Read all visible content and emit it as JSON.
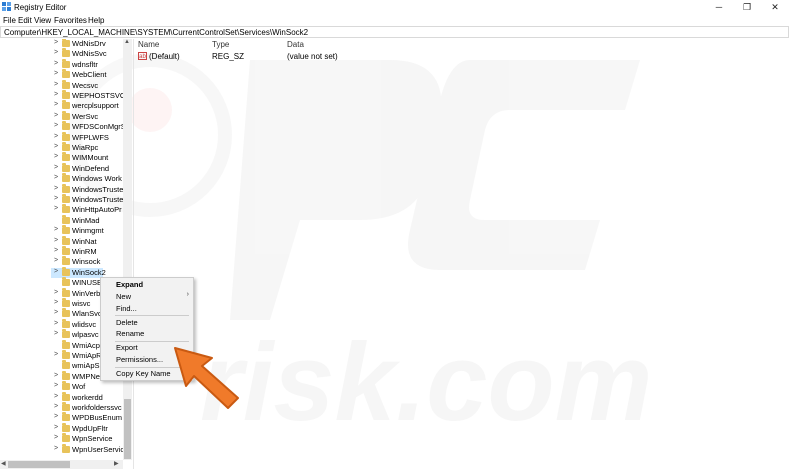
{
  "window": {
    "title": "Registry Editor",
    "minimize": "─",
    "maximize": "❐",
    "close": "✕"
  },
  "menu": [
    "File",
    "Edit",
    "View",
    "Favorites",
    "Help"
  ],
  "address": "Computer\\HKEY_LOCAL_MACHINE\\SYSTEM\\CurrentControlSet\\Services\\WinSock2",
  "tree": [
    {
      "label": "WdNisDrv",
      "chevron": ">"
    },
    {
      "label": "WdNisSvc",
      "chevron": ">"
    },
    {
      "label": "wdnsfltr",
      "chevron": ">"
    },
    {
      "label": "WebClient",
      "chevron": ">"
    },
    {
      "label": "Wecsvc",
      "chevron": ">"
    },
    {
      "label": "WEPHOSTSVC",
      "chevron": ">"
    },
    {
      "label": "wercplsupport",
      "chevron": ">"
    },
    {
      "label": "WerSvc",
      "chevron": ">"
    },
    {
      "label": "WFDSConMgrS",
      "chevron": ">"
    },
    {
      "label": "WFPLWFS",
      "chevron": ">"
    },
    {
      "label": "WiaRpc",
      "chevron": ">"
    },
    {
      "label": "WIMMount",
      "chevron": ">"
    },
    {
      "label": "WinDefend",
      "chevron": ">"
    },
    {
      "label": "Windows Work",
      "chevron": ">"
    },
    {
      "label": "WindowsTruste",
      "chevron": ">"
    },
    {
      "label": "WindowsTruste",
      "chevron": ">"
    },
    {
      "label": "WinHttpAutoPr",
      "chevron": ">"
    },
    {
      "label": "WinMad",
      "chevron": ""
    },
    {
      "label": "Winmgmt",
      "chevron": ">"
    },
    {
      "label": "WinNat",
      "chevron": ">"
    },
    {
      "label": "WinRM",
      "chevron": ">"
    },
    {
      "label": "Winsock",
      "chevron": ">"
    },
    {
      "label": "WinSock2",
      "chevron": ">",
      "selected": true
    },
    {
      "label": "WINUSB",
      "chevron": ""
    },
    {
      "label": "WinVerb",
      "chevron": ">"
    },
    {
      "label": "wisvc",
      "chevron": ">"
    },
    {
      "label": "WlanSvc",
      "chevron": ">"
    },
    {
      "label": "wlidsvc",
      "chevron": ">"
    },
    {
      "label": "wlpasvc",
      "chevron": ">"
    },
    {
      "label": "WmiAcp",
      "chevron": ""
    },
    {
      "label": "WmiApR",
      "chevron": ">"
    },
    {
      "label": "wmiApSr",
      "chevron": ""
    },
    {
      "label": "WMPNetwork",
      "chevron": ">"
    },
    {
      "label": "Wof",
      "chevron": ">"
    },
    {
      "label": "workerdd",
      "chevron": ">"
    },
    {
      "label": "workfolderssvc",
      "chevron": ">"
    },
    {
      "label": "WPDBusEnum",
      "chevron": ">"
    },
    {
      "label": "WpdUpFltr",
      "chevron": ">"
    },
    {
      "label": "WpnService",
      "chevron": ">"
    },
    {
      "label": "WpnUserServic",
      "chevron": ">"
    }
  ],
  "columns": {
    "name": "Name",
    "type": "Type",
    "data": "Data"
  },
  "values": [
    {
      "icon": "ab",
      "name": "(Default)",
      "type": "REG_SZ",
      "data": "(value not set)"
    }
  ],
  "context_menu": {
    "expand": "Expand",
    "new": "New",
    "find": "Find...",
    "delete": "Delete",
    "rename": "Rename",
    "export": "Export",
    "permissions": "Permissions...",
    "copy_key_name": "Copy Key Name"
  },
  "colors": {
    "selection": "#cce8ff",
    "arrow": "#f07a2a",
    "folder": "#e8c35a"
  },
  "icons": {
    "submenu": "›"
  }
}
